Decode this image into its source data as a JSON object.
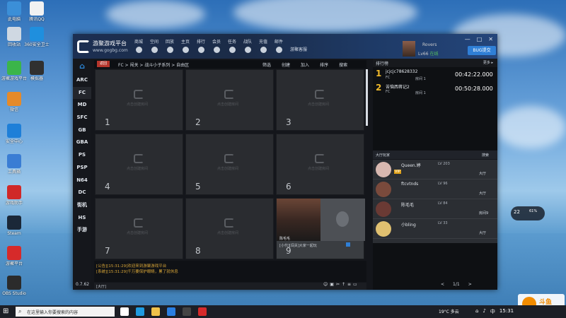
{
  "desktop": {
    "icons": [
      {
        "label": "此电脑",
        "color": "#3b8fd8"
      },
      {
        "label": "腾讯QQ",
        "color": "#f2f2f2"
      },
      {
        "label": "回收站",
        "color": "#cfd8e2"
      },
      {
        "label": "360安全卫士",
        "color": "#1f8fde"
      },
      {
        "label": "游聚游戏平台",
        "color": "#3bb54a"
      },
      {
        "label": "模拟器",
        "color": "#303030"
      },
      {
        "label": "微信",
        "color": "#e58a2a"
      },
      {
        "label": "安全中心",
        "color": "#1e7fd8"
      },
      {
        "label": "工具箱",
        "color": "#3a7dd4"
      },
      {
        "label": "游戏助手",
        "color": "#d02828"
      },
      {
        "label": "Steam",
        "color": "#1b2838"
      },
      {
        "label": "游聚平台",
        "color": "#d62a2a"
      },
      {
        "label": "OBS Studio",
        "color": "#2b2b2b"
      }
    ]
  },
  "app": {
    "brand": "游聚游戏平台",
    "brand_url": "www.gogbg.com",
    "nav": [
      "商城",
      "空间",
      "回放",
      "主页",
      "排行",
      "会员",
      "任务",
      "战队",
      "充值",
      "邮件"
    ],
    "nav_extra": "游聚客服",
    "user": {
      "name": "Rovers",
      "level": "Lv66",
      "status": "在线"
    },
    "bug_button": "BUG提交",
    "window_controls": [
      "—",
      "□",
      "✕"
    ],
    "sidebar": {
      "home_icon": "home-icon",
      "items": [
        "ARC",
        "FC",
        "MD",
        "SFC",
        "GB",
        "GBA",
        "PS",
        "PSP",
        "N64",
        "DC",
        "街机",
        "HS",
        "手游"
      ],
      "version": "0.7.62"
    },
    "breadcrumb": {
      "tab": "返回",
      "path": "FC > 闯关 > 战斗小子系列 > 自由区",
      "actions": [
        "筛选",
        "创建",
        "加入",
        "排序",
        "搜索"
      ]
    },
    "rooms": [
      {
        "number": "1",
        "hint": "点击创建房间"
      },
      {
        "number": "2",
        "hint": "点击创建房间"
      },
      {
        "number": "3",
        "hint": "点击创建房间"
      },
      {
        "number": "4",
        "hint": "点击创建房间"
      },
      {
        "number": "5",
        "hint": "点击创建房间"
      },
      {
        "number": "6",
        "hint": "点击创建房间"
      },
      {
        "number": "7",
        "hint": "点击创建房间"
      },
      {
        "number": "8",
        "hint": "点击创建房间"
      },
      {
        "number": "9",
        "hint": "",
        "player_name": "陈毛毛",
        "room_title": "[小代][闯关]大家一起玩"
      }
    ],
    "chat": {
      "lines": [
        "[公告][15:31:29]欢迎来到游聚游戏平台",
        "[系统][15:31:29]千万要保护眼睛，累了就休息"
      ],
      "channel": "[大厅]",
      "tools": [
        "☺",
        "▣",
        "✂",
        "↑",
        "≡",
        "▭"
      ]
    },
    "ranking": {
      "title": "排行榜",
      "more": "更多 ▸",
      "entries": [
        {
          "rank": "1",
          "name": "jcjcjc78628332",
          "game": "FC",
          "room": "房间 1",
          "time": "00:42:22.000"
        },
        {
          "rank": "2",
          "name": "苦恼西蒋记2",
          "game": "FC",
          "room": "房间 1",
          "time": "00:50:28.000"
        }
      ]
    },
    "lobby": {
      "title": "大厅玩家",
      "search": "搜索",
      "players": [
        {
          "name": "Queen.婷",
          "level": "LV 203",
          "room": "大厅",
          "badge": "VIP",
          "avatar_color": "#d8b8b0"
        },
        {
          "name": "ftcvtnds",
          "level": "LV 96",
          "room": "大厅",
          "badge": "",
          "avatar_color": "#7a4a3c"
        },
        {
          "name": "陈毛毛",
          "level": "LV 84",
          "room": "房间9",
          "badge": "",
          "avatar_color": "#6a3a34"
        },
        {
          "name": "小bling",
          "level": "LV 33",
          "room": "大厅",
          "badge": "",
          "avatar_color": "#e0c070"
        }
      ],
      "pager": {
        "prev": "<",
        "page": "1/1",
        "next": ">"
      }
    }
  },
  "taskbar": {
    "search_placeholder": "在这里输入你要搜索的内容",
    "weather": "19°C 多云",
    "time": "15:31"
  },
  "widget": {
    "temp": "22",
    "info": "61%"
  },
  "watermark": {
    "title": "斗鱼",
    "sub": "DOUYU.COM"
  }
}
